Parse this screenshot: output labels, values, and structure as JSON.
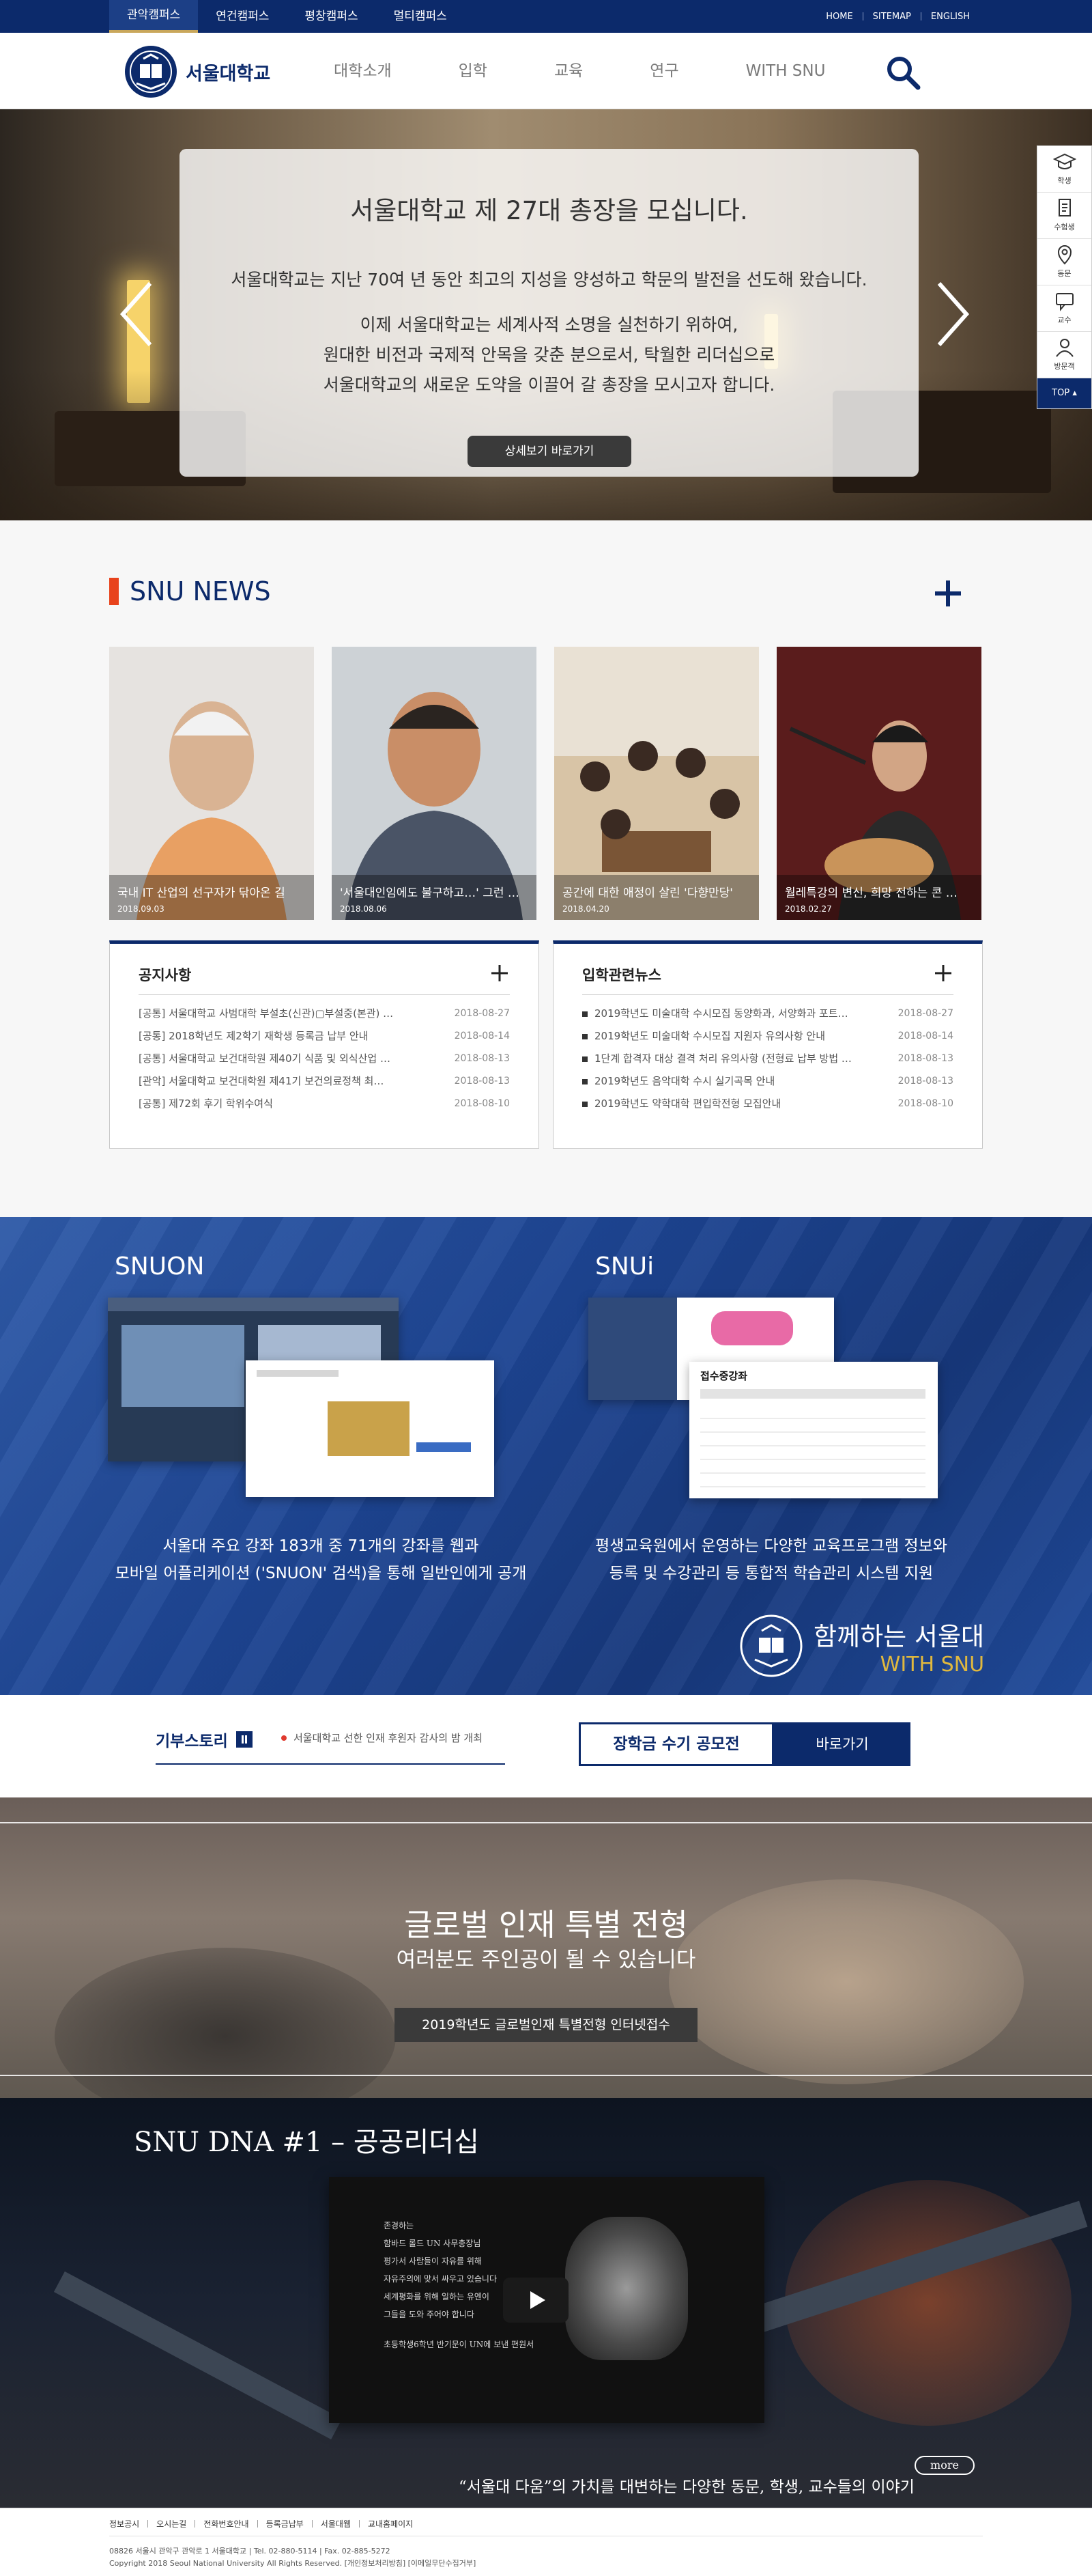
{
  "colors": {
    "brand_navy": "#0c2a6b",
    "accent_red": "#e8431c",
    "gold": "#e0b83e"
  },
  "campus_tabs": [
    "관악캠퍼스",
    "연건캠퍼스",
    "평창캠퍼스",
    "멀티캠퍼스"
  ],
  "util_links": [
    "HOME",
    "SITEMAP",
    "ENGLISH"
  ],
  "logo": {
    "text": "서울대학교",
    "icon": "snu-emblem-icon"
  },
  "gnb": [
    "대학소개",
    "입학",
    "교육",
    "연구",
    "WITH SNU"
  ],
  "hero": {
    "title": "서울대학교 제 27대 총장을 모십니다.",
    "line1": "서울대학교는 지난 70여 년 동안 최고의 지성을 양성하고 학문의 발전을 선도해 왔습니다.",
    "line2": "이제 서울대학교는 세계사적 소명을 실천하기 위하여,",
    "line3": "원대한 비전과 국제적 안목을 갖춘 분으로서, 탁월한 리더십으로",
    "line4": "서울대학교의 새로운 도약을 이끌어 갈 총장을 모시고자 합니다.",
    "button": "상세보기 바로가기"
  },
  "quick_menu": {
    "items": [
      {
        "label": "학생",
        "icon": "graduation-cap-icon"
      },
      {
        "label": "수험생",
        "icon": "document-icon"
      },
      {
        "label": "동문",
        "icon": "location-pin-icon"
      },
      {
        "label": "교수",
        "icon": "chat-icon"
      },
      {
        "label": "방문객",
        "icon": "person-icon"
      }
    ],
    "top": "TOP"
  },
  "news": {
    "title": "SNU NEWS",
    "cards": [
      {
        "title": "국내 IT 산업의 선구자가 닦아온 길",
        "date": "2018.09.03"
      },
      {
        "title": "'서울대인임에도 불구하고…' 그런 …",
        "date": "2018.08.06"
      },
      {
        "title": "공간에 대한 애정이 살린 '다향만당'",
        "date": "2018.04.20"
      },
      {
        "title": "월레특강의 변신, 희망 전하는 콘 …",
        "date": "2018.02.27"
      }
    ]
  },
  "notice": {
    "title": "공지사항",
    "rows": [
      {
        "title": "[공통] 서울대학교 사범대학 부설초(신관)▢부설중(본관) …",
        "date": "2018-08-27"
      },
      {
        "title": "[공통] 2018학년도 제2학기 재학생 등록금 납부 안내",
        "date": "2018-08-14"
      },
      {
        "title": "[공통] 서울대학교 보건대학원 제40기 식품 및 외식산업 …",
        "date": "2018-08-13"
      },
      {
        "title": "[관악] 서울대학교 보건대학원 제41기 보건의료정책 최…",
        "date": "2018-08-13"
      },
      {
        "title": "[공통] 제72회 후기 학위수여식",
        "date": "2018-08-10"
      }
    ]
  },
  "admission": {
    "title": "입학관련뉴스",
    "rows": [
      {
        "title": "2019학년도 미술대학 수시모집 동양화과, 서양화과 포트…",
        "date": "2018-08-27"
      },
      {
        "title": "2019학년도 미술대학 수시모집 지원자 유의사항 안내",
        "date": "2018-08-14"
      },
      {
        "title": "1단계 합격자 대상 결격 처리 유의사항 (전형료 납부 방법 …",
        "date": "2018-08-13"
      },
      {
        "title": "2019학년도 음악대학 수시 실기곡목 안내",
        "date": "2018-08-13"
      },
      {
        "title": "2019학년도 약학대학 편입학전형 모집안내",
        "date": "2018-08-10"
      }
    ]
  },
  "with_snu": {
    "snuon": {
      "title": "SNUON",
      "desc1": "서울대 주요 강좌 183개 중 71개의 강좌를 웹과",
      "desc2": "모바일 어플리케이션 ('SNUON' 검색)을 통해 일반인에게 공개"
    },
    "snui": {
      "title": "SNUi",
      "desc1": "평생교육원에서 운영하는 다양한 교육프로그램 정보와",
      "desc2": "등록 및 수강관리 등 통합적 학습관리 시스템 지원",
      "shot_heading": "접수중강좌"
    },
    "brand_ko": "함께하는 서울대",
    "brand_en": "WITH SNU"
  },
  "donation": {
    "label": "기부스토리",
    "news": "서울대학교 선한 인재 후원자 감사의 밤 개최",
    "banner_left": "장학금 수기 공모전",
    "banner_right": "바로가기"
  },
  "global": {
    "title": "글로벌 인재 특별 전형",
    "subtitle": "여러분도 주인공이 될 수 있습니다",
    "button": "2019학년도 글로벌인재 특별전형 인터넷접수"
  },
  "dna": {
    "title": "SNU DNA #1 – 공공리더십",
    "video_lines": [
      "존경하는",
      "함바드 롤드 UN 사무총장님",
      "평가서 사람들이 자유를 위해",
      "자유주의에 맞서 싸우고 있습니다",
      "세계평화를 위해 일하는 유엔이",
      "그들을 도와 주어야 합니다",
      "초등학생6학년 반기문이 UN에 보낸 편원서"
    ],
    "caption": "“서울대 다움”의 가치를 대변하는 다양한 동문, 학생, 교수들의 이야기",
    "more": "more"
  },
  "footer": {
    "links": [
      "정보공시",
      "오시는길",
      "전화번호안내",
      "등록금납부",
      "서울대웹",
      "교내홈페이지"
    ],
    "address": "08826 서울시 관악구 관악로 1 서울대학교 | Tel. 02-880-5114 | Fax. 02-885-5272",
    "copyright": "Copyright 2018 Seoul National University All Rights Reserved. [개인정보처리방침] [이메일무단수집거부]"
  }
}
